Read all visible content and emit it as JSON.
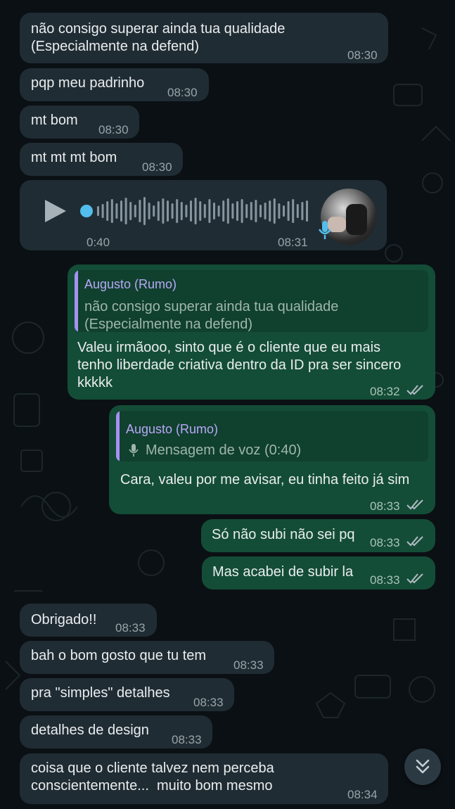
{
  "colors": {
    "background": "#0b1014",
    "incoming_bubble": "#202c33",
    "outgoing_bubble": "#144d37",
    "quote_accent": "#a791f4",
    "read_ticks": "#b0bcc2",
    "voice_mic": "#53bdeb"
  },
  "messages": {
    "m1": {
      "text": "não consigo superar ainda tua qualidade\n(Especialmente na defend)",
      "time": "08:30"
    },
    "m2": {
      "text": "pqp meu padrinho",
      "time": "08:30"
    },
    "m3": {
      "text": "mt bom",
      "time": "08:30"
    },
    "m4": {
      "text": "mt mt mt bom",
      "time": "08:30"
    },
    "voice": {
      "duration": "0:40",
      "time": "08:31",
      "icons": [
        "play-icon",
        "mic-icon",
        "avatar"
      ]
    },
    "o1": {
      "quote_author": "Augusto (Rumo)",
      "quote_text": "não consigo superar ainda tua qualidade\n(Especialmente na defend)",
      "text": "Valeu irmãooo, sinto que é o cliente que eu mais\ntenho liberdade criativa dentro da ID pra ser sincero\nkkkkk",
      "time": "08:32"
    },
    "o2": {
      "quote_author": "Augusto (Rumo)",
      "quote_text": "Mensagem de voz (0:40)",
      "text": "Cara, valeu por me avisar, eu tinha feito já sim",
      "time": "08:33"
    },
    "o3": {
      "text": "Só não subi não sei pq",
      "time": "08:33"
    },
    "o4": {
      "text": "Mas acabei de subir la",
      "time": "08:33"
    },
    "m5": {
      "text": "Obrigado!!",
      "time": "08:33"
    },
    "m6": {
      "text": "bah o bom gosto que tu tem",
      "time": "08:33"
    },
    "m7": {
      "text": "pra \"simples\" detalhes",
      "time": "08:33"
    },
    "m8": {
      "text": "detalhes de design",
      "time": "08:33"
    },
    "m9": {
      "text": "coisa que o cliente talvez nem perceba\nconscientemente...  muito bom mesmo",
      "time": "08:34"
    }
  },
  "scroll_button_icon": "double-chevron-down-icon"
}
